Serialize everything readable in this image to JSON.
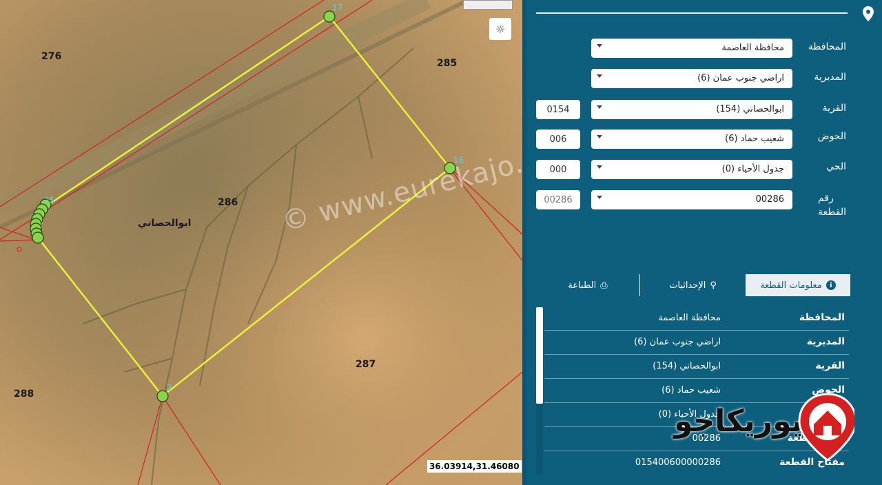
{
  "map": {
    "parcel_numbers": [
      "276",
      "285",
      "286",
      "287",
      "288"
    ],
    "village_label": "ابوالحصاني",
    "vertex_labels": [
      "17",
      "16",
      "2",
      "25"
    ],
    "watermark": "© www.eurekajo.com",
    "coordinates": "36.03914,31.46080",
    "brightness_icon": "sun-icon"
  },
  "form": {
    "rows": [
      {
        "label": "المحافظة",
        "value": "محافظة العاصمة",
        "code": ""
      },
      {
        "label": "المديرية",
        "value": "اراضي جنوب عمان (6)",
        "code": ""
      },
      {
        "label": "القرية",
        "value": "ابوالحصاني (154)",
        "code": "0154"
      },
      {
        "label": "الحوض",
        "value": "شعيب حماد (6)",
        "code": "006"
      },
      {
        "label": "الحي",
        "value": "جدول الأحياء (0)",
        "code": "000"
      },
      {
        "label_line1": "رقم",
        "label_line2": "القطعة",
        "value": "00286",
        "code": "00286"
      }
    ]
  },
  "tabs": [
    {
      "label": "معلومات القطعة",
      "icon": "info-icon",
      "active": true
    },
    {
      "label": "الإحداثيات",
      "icon": "location-icon",
      "active": false
    },
    {
      "label": "الطباعة",
      "icon": "printer-icon",
      "active": false
    }
  ],
  "info": [
    {
      "key": "المحافظة",
      "value": "محافظة العاصمة"
    },
    {
      "key": "المديرية",
      "value": "اراضي جنوب عمان (6)"
    },
    {
      "key": "القرية",
      "value": "ابوالحصاني (154)"
    },
    {
      "key": "الحوض",
      "value": "شعيب حماد (6)"
    },
    {
      "key": "الحي",
      "value": "جدول الأحياء (0)"
    },
    {
      "key": "رقم القطعة",
      "value": "00286"
    },
    {
      "key": "مفتاح القطعة",
      "value": "015400600000286"
    }
  ],
  "logo": {
    "text": "يوريكاجو",
    "icon": "house-logo-icon"
  },
  "colors": {
    "panel": "#0e5f7e",
    "parcel_outline": "#e8f23a",
    "vertex": "#8bd44a",
    "boundary": "#d42020"
  }
}
